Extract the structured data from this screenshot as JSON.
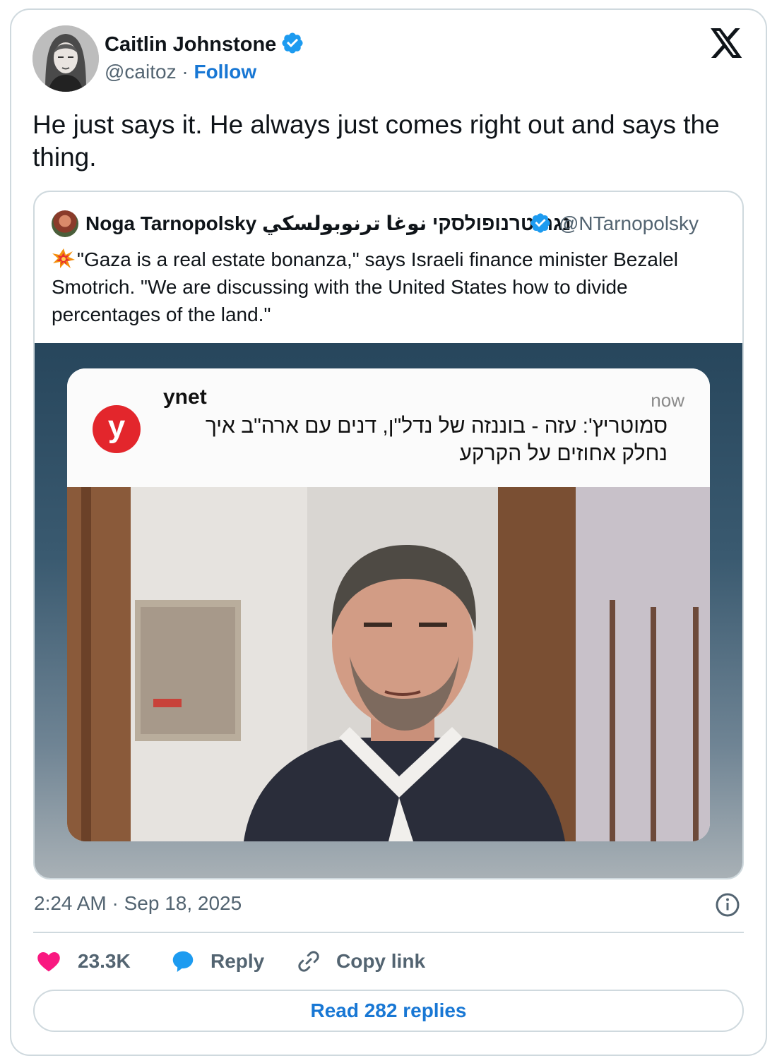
{
  "author": {
    "name": "Caitlin Johnstone",
    "handle": "@caitoz",
    "separator": "·",
    "follow_label": "Follow"
  },
  "tweet": {
    "text": "He just says it. He always just comes right out and says the thing."
  },
  "quote": {
    "name": "Noga Tarnopolsky נגה טרנופולסקי نوغا ترنوبولسكي",
    "handle": "@NTarnopolsky",
    "text": "\"Gaza is a real estate bonanza,\" says Israeli finance minister Bezalel Smotrich. \"We are discussing with the United States how to divide percentages of the land.\"",
    "notification": {
      "app": "ynet",
      "logo_letter": "y",
      "time": "now",
      "headline": "סמוטריץ': עזה - בוננזה של נדל\"ן, דנים עם ארה\"ב איך נחלק אחוזים על הקרקע"
    }
  },
  "meta": {
    "timestamp": "2:24 AM · Sep 18, 2025"
  },
  "actions": {
    "likes": "23.3K",
    "reply_label": "Reply",
    "copy_label": "Copy link"
  },
  "read_replies_label": "Read 282 replies",
  "colors": {
    "link_blue": "#1877d4",
    "verified_blue": "#1d9bf0",
    "like_pink": "#f91880",
    "ynet_red": "#e3262c"
  },
  "icons": [
    "verified-badge-icon",
    "x-logo-icon",
    "info-icon",
    "heart-icon",
    "reply-bubble-icon",
    "link-icon",
    "collision-emoji-icon"
  ]
}
